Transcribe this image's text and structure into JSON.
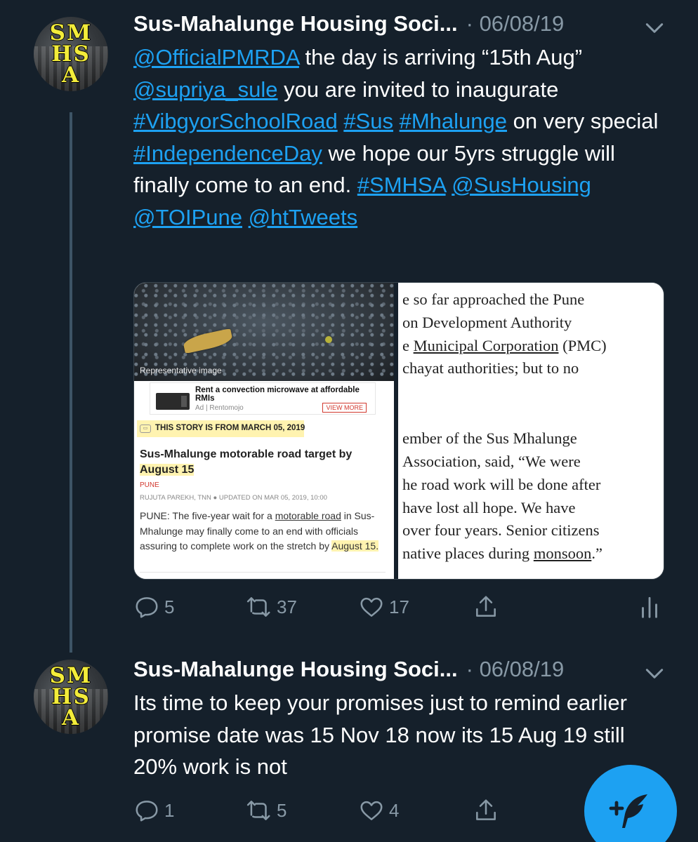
{
  "tweets": [
    {
      "avatar_text": [
        "SM",
        "HS",
        "A"
      ],
      "author": "Sus-Mahalunge Housing Soci...",
      "date_sep": "·",
      "date": "06/08/19",
      "text_parts": [
        {
          "t": "@OfficialPMRDA",
          "link": true
        },
        {
          "t": " the day is arriving “15th Aug” ",
          "link": false
        },
        {
          "t": "@supriya_sule",
          "link": true
        },
        {
          "t": " you are invited to inaugurate ",
          "link": false
        },
        {
          "t": "#VibgyorSchoolRoad",
          "link": true
        },
        {
          "t": " ",
          "link": false
        },
        {
          "t": "#Sus",
          "link": true
        },
        {
          "t": " ",
          "link": false
        },
        {
          "t": "#Mhalunge",
          "link": true
        },
        {
          "t": " on very special ",
          "link": false
        },
        {
          "t": "#IndependenceDay",
          "link": true
        },
        {
          "t": " we hope our 5yrs struggle will finally come to an end. ",
          "link": false
        },
        {
          "t": "#SMHSA",
          "link": true
        },
        {
          "t": " ",
          "link": false
        },
        {
          "t": "@SusHousing",
          "link": true
        },
        {
          "t": " ",
          "link": false
        },
        {
          "t": "@TOIPune",
          "link": true
        },
        {
          "t": " ",
          "link": false
        },
        {
          "t": "@htTweets",
          "link": true
        }
      ],
      "media": {
        "left": {
          "image_caption": "Representative image",
          "ad_title": "Rent a convection microwave at affordable RMIs",
          "ad_source": "Ad | Rentomojo",
          "ad_button": "VIEW MORE",
          "story_tag": "THIS STORY IS FROM MARCH 05, 2019",
          "headline_a": "Sus-Mhalunge motorable road target by ",
          "headline_b": "August 15",
          "section": "PUNE",
          "byline": "RUJUTA PAREKH, TNN  ●  UPDATED ON MAR 05, 2019, 10:00",
          "body_1": "PUNE: The five-year wait for a ",
          "body_link": "motorable road",
          "body_2": " in Sus-Mhalunge may finally come to an end with officials assuring to complete work on the stretch by ",
          "body_hl": "August 15."
        },
        "right": {
          "lines_top": [
            {
              "a": "e so far approached the Pune",
              "u": "",
              "b": ""
            },
            {
              "a": "on Development Authority",
              "u": "",
              "b": ""
            },
            {
              "a": "e ",
              "u": "Municipal Corporation",
              "b": " (PMC)"
            },
            {
              "a": "chayat authorities; but to no",
              "u": "",
              "b": ""
            }
          ],
          "lines_bottom": [
            {
              "a": "ember of the Sus Mhalunge",
              "u": "",
              "b": ""
            },
            {
              "a": " Association, said, “We were",
              "u": "",
              "b": ""
            },
            {
              "a": "he road work will be done after",
              "u": "",
              "b": ""
            },
            {
              "a": " have lost all hope. We have",
              "u": "",
              "b": ""
            },
            {
              "a": "over four years. Senior citizens",
              "u": "",
              "b": ""
            },
            {
              "a": " native places during ",
              "u": "monsoon",
              "b": ".”"
            }
          ]
        }
      },
      "actions": {
        "replies": "5",
        "retweets": "37",
        "likes": "17"
      }
    },
    {
      "avatar_text": [
        "SM",
        "HS",
        "A"
      ],
      "author": "Sus-Mahalunge Housing Soci...",
      "date_sep": "·",
      "date": "06/08/19",
      "text": "Its time to keep your promises just to remind earlier promise date was 15 Nov 18 now its 15 Aug 19 still 20% work is not",
      "actions": {
        "replies": "1",
        "retweets": "5",
        "likes": "4"
      }
    }
  ],
  "colors": {
    "background": "#15202b",
    "link": "#1da1f2",
    "muted": "#8899a6",
    "fab": "#1da1f2"
  },
  "icons": [
    "chevron-down-icon",
    "reply-icon",
    "retweet-icon",
    "like-icon",
    "share-icon",
    "analytics-icon",
    "compose-tweet-icon"
  ]
}
